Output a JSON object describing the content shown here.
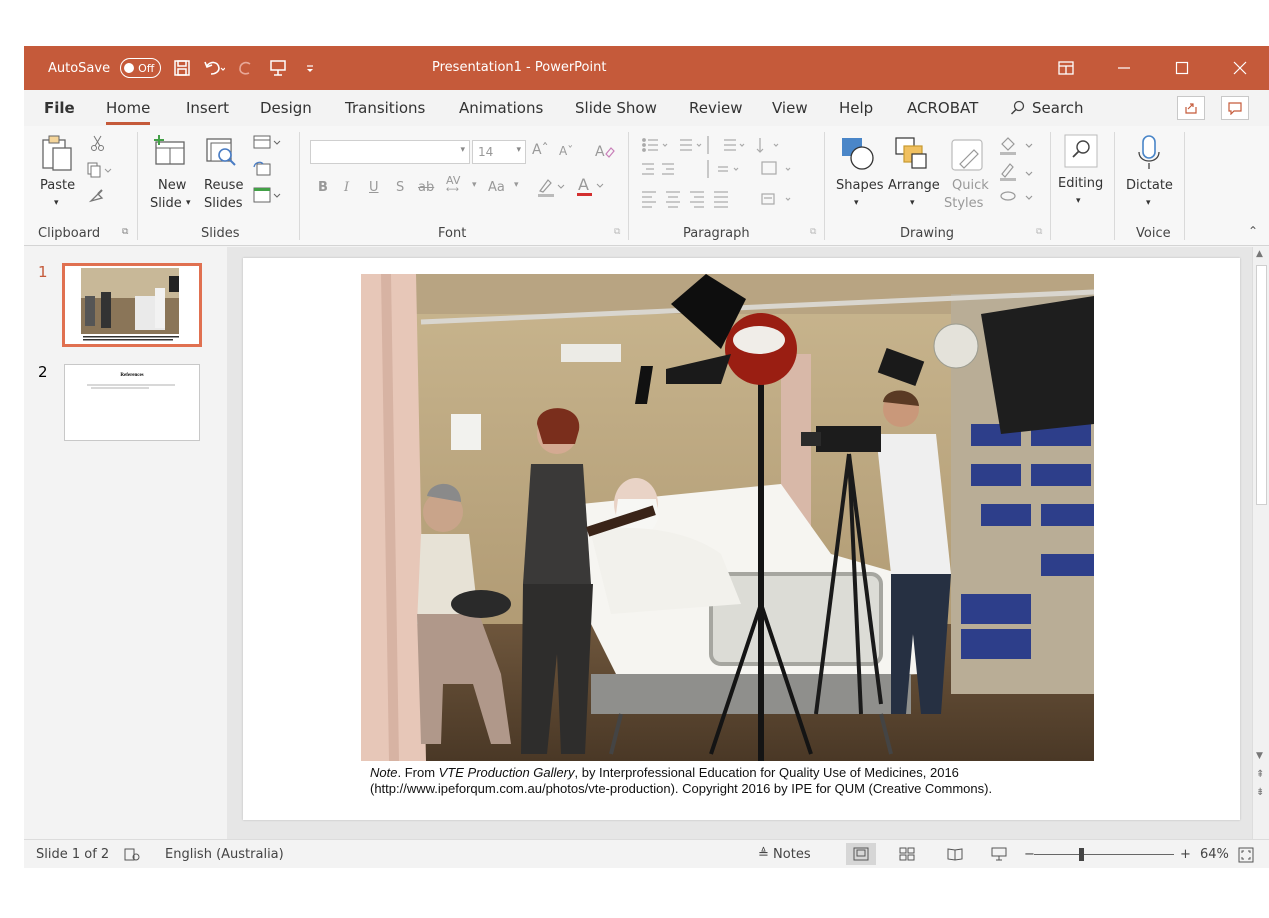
{
  "titlebar": {
    "autosave_label": "AutoSave",
    "autosave_state": "Off",
    "doc_title": "Presentation1  -  PowerPoint"
  },
  "tabs": [
    "File",
    "Home",
    "Insert",
    "Design",
    "Transitions",
    "Animations",
    "Slide Show",
    "Review",
    "View",
    "Help",
    "ACROBAT"
  ],
  "search_label": "Search",
  "ribbon": {
    "clipboard": {
      "paste": "Paste",
      "label": "Clipboard"
    },
    "slides": {
      "new_slide_1": "New",
      "new_slide_2": "Slide",
      "reuse_1": "Reuse",
      "reuse_2": "Slides",
      "label": "Slides"
    },
    "font": {
      "size": "14",
      "label": "Font",
      "bold": "B",
      "italic": "I",
      "underline": "U",
      "shadow": "S",
      "strike": "ab",
      "spacing": "AV",
      "case": "Aa",
      "grow": "A",
      "shrink": "A",
      "color": "A"
    },
    "paragraph": {
      "label": "Paragraph"
    },
    "drawing": {
      "shapes": "Shapes",
      "arrange": "Arrange",
      "quick_1": "Quick",
      "quick_2": "Styles",
      "label": "Drawing"
    },
    "editing": {
      "label": "Editing"
    },
    "voice": {
      "dictate": "Dictate",
      "label": "Voice"
    }
  },
  "slides": [
    {
      "num": "1"
    },
    {
      "num": "2",
      "thumb_title": "References"
    }
  ],
  "caption": {
    "note_italic": "Note",
    "from_text": ". From ",
    "source_italic": "VTE Production Gallery",
    "rest_line1": ", by Interprofessional Education for Quality Use of Medicines, 2016",
    "line2": "(http://www.ipeforqum.com.au/photos/vte-production). Copyright 2016 by IPE for QUM (Creative Commons)."
  },
  "status": {
    "slide_of": "Slide 1 of 2",
    "language": "English (Australia)",
    "notes": "Notes",
    "zoom": "64%"
  },
  "colors": {
    "accent": "#c55a3a",
    "selected_thumb": "#e07050"
  }
}
